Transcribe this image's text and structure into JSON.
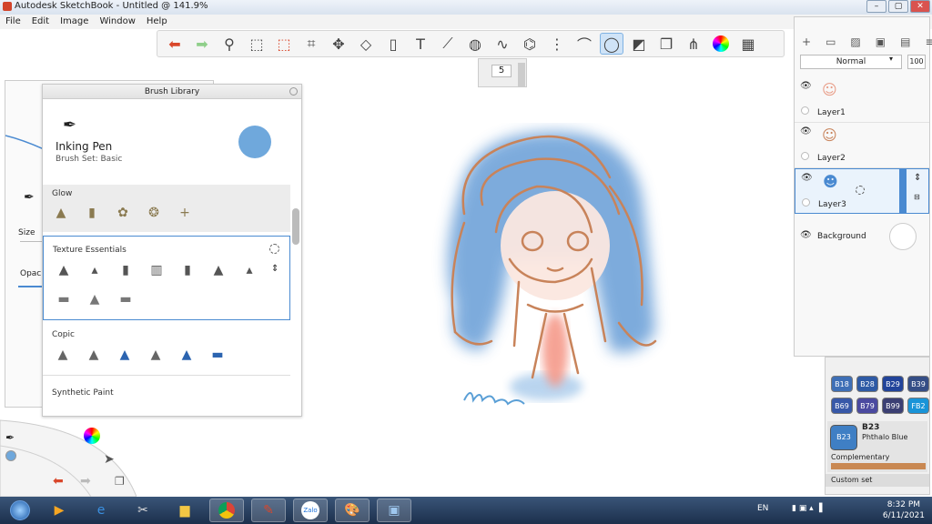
{
  "window": {
    "title": "Autodesk SketchBook - Untitled @ 141.9%"
  },
  "menu": [
    "File",
    "Edit",
    "Image",
    "Window",
    "Help"
  ],
  "toolbar": {
    "tools": [
      "undo-icon",
      "redo-icon",
      "zoom-icon",
      "select-rect-icon",
      "select-lasso-icon",
      "crop-icon",
      "transform-icon",
      "distort-icon",
      "fill-icon",
      "text-icon",
      "ruler-icon",
      "ellipse-guide-icon",
      "french-curve-icon",
      "perspective-icon",
      "symmetry-icon",
      "stroke-icon",
      "predictive-stroke-icon",
      "shape-icon",
      "copy-paste-icon",
      "brush-set-icon",
      "color-wheel-icon",
      "swatches-icon"
    ],
    "active_tool": "predictive-stroke-icon"
  },
  "brush_size_popup": {
    "value": "5"
  },
  "brush_props": {
    "size_label": "Size",
    "opacity_label": "Opacit"
  },
  "brush_library": {
    "title": "Brush Library",
    "current_brush": {
      "name": "Inking Pen",
      "set": "Brush Set: Basic",
      "color": "#6fa8dc"
    },
    "sections": [
      {
        "title": "Glow",
        "count": 5
      },
      {
        "title": "Texture Essentials",
        "count": 10
      },
      {
        "title": "Copic",
        "count": 6
      },
      {
        "title": "Synthetic Paint",
        "count": 0
      }
    ]
  },
  "layers": {
    "blend_mode": "Normal",
    "opacity": "100",
    "items": [
      {
        "name": "Layer1",
        "selected": false
      },
      {
        "name": "Layer2",
        "selected": false
      },
      {
        "name": "Layer3",
        "selected": true
      },
      {
        "name": "Background",
        "selected": false
      }
    ]
  },
  "colors": {
    "swatch_rows": [
      [
        {
          "code": "B18",
          "color": "#3e6fb6"
        },
        {
          "code": "B28",
          "color": "#2e5aa5"
        },
        {
          "code": "B29",
          "color": "#22449a"
        },
        {
          "code": "B39",
          "color": "#354e86"
        }
      ],
      [
        {
          "code": "B69",
          "color": "#3758a8"
        },
        {
          "code": "B79",
          "color": "#4b4aa0"
        },
        {
          "code": "B99",
          "color": "#3b3f73"
        },
        {
          "code": "FB2",
          "color": "#1994d8"
        }
      ]
    ],
    "current": {
      "code": "B23",
      "name": "Phthalo Blue",
      "color": "#3f7fc4"
    },
    "complementary_label": "Complementary",
    "complementary_color": "#c98852",
    "custom_set_label": "Custom set"
  },
  "taskbar": {
    "time": "8:32 PM",
    "date": "6/11/2021",
    "lang": "EN"
  }
}
